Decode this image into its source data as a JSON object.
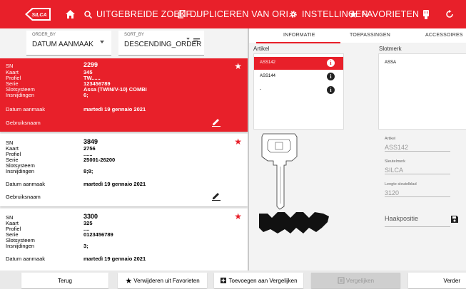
{
  "topbar": {
    "search_label": "UITGEBREIDE ZOEKF...",
    "duplicate_label": "DUPLICEREN VAN ORI...",
    "settings_label": "INSTELLINGEN",
    "favorites_label": "FAVORIETEN",
    "logo_text": "SILCA",
    "bg_color": "#e8202a"
  },
  "sort": {
    "order_by_caption": "ORDER_BY",
    "order_by_value": "DATUM AANMAAK",
    "sort_by_caption": "SORT_BY",
    "sort_by_value": "DESCENDING_ORDER"
  },
  "cards": [
    {
      "sn_label": "SN",
      "sn": "2299",
      "kaart_label": "Kaart",
      "kaart": "345",
      "profiel_label": "Profiel",
      "profiel": "TW......",
      "serie_label": "Serie",
      "serie": "123456789",
      "slot_label": "Slotsysteem",
      "slot": "Assa (TWIN/V-10) COMBI",
      "insn_label": "Insnijdingen",
      "insn": "6;",
      "datum_label": "Datum aanmaak",
      "datum": "martedì 19 gennaio 2021",
      "gebruik_label": "Gebruiksnaam"
    },
    {
      "sn_label": "SN",
      "sn": "3849",
      "kaart_label": "Kaart",
      "kaart": "2756",
      "profiel_label": "Profiel",
      "profiel": "......",
      "serie_label": "Serie",
      "serie": "25001-26200",
      "slot_label": "Slotsysteem",
      "slot": "",
      "insn_label": "Insnijdingen",
      "insn": "8;8;",
      "datum_label": "Datum aanmaak",
      "datum": "martedì 19 gennaio 2021",
      "gebruik_label": "Gebruiksnaam"
    },
    {
      "sn_label": "SN",
      "sn": "3300",
      "kaart_label": "Kaart",
      "kaart": "325",
      "profiel_label": "Profiel",
      "profiel": "....",
      "serie_label": "Serie",
      "serie": "0123456789",
      "slot_label": "Slotsysteem",
      "slot": "",
      "insn_label": "Insnijdingen",
      "insn": "3;",
      "datum_label": "Datum aanmaak",
      "datum": "martedì 19 gennaio 2021"
    }
  ],
  "tabs": [
    "INFORMATIE",
    "TOEPASSINGEN",
    "ACCESSOIRES"
  ],
  "artikel": {
    "label": "Artikel",
    "items": [
      "ASS142",
      "ASS144",
      "-"
    ]
  },
  "slotmerk": {
    "label": "Slotmerk",
    "items": [
      "ASSA"
    ]
  },
  "details": {
    "artikel_caption": "Artikel",
    "artikel_value": "ASS142",
    "sleutelmerk_caption": "Sleutelmerk",
    "sleutelmerk_value": "SILCA",
    "lengte_caption": "Lengte sleutelblad",
    "lengte_value": "3120",
    "haak_label": "Haakpositie"
  },
  "bottom": {
    "terug": "Terug",
    "verwijderen": "Verwijderen uit Favorieten",
    "toevoegen": "Toevoegen aan Vergelijken",
    "vergelijken": "Vergelijken",
    "verder": "Verder"
  }
}
